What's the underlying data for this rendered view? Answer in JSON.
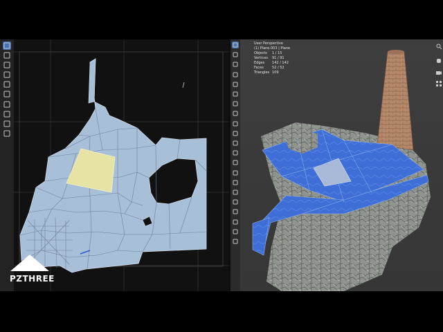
{
  "uv_editor": {
    "toolbar": [
      {
        "icon": "cursor-icon",
        "active": true
      },
      {
        "icon": "cursor-3d-icon",
        "active": false
      },
      {
        "icon": "move-icon",
        "active": false
      },
      {
        "icon": "rotate-icon",
        "active": false
      },
      {
        "icon": "scale-icon",
        "active": false
      },
      {
        "icon": "transform-icon",
        "active": false
      },
      {
        "icon": "annotate-icon",
        "active": false
      },
      {
        "icon": "grab-icon",
        "active": false
      },
      {
        "icon": "relax-icon",
        "active": false
      },
      {
        "icon": "pinch-icon",
        "active": false
      }
    ],
    "selected_face_color": "#e6e3a5",
    "island_color": "#a8bfd8"
  },
  "viewport": {
    "info": {
      "view": "User Perspective",
      "object": "(1) Plane.003 | Plane",
      "stats": [
        {
          "label": "Objects",
          "value": "1 / 15"
        },
        {
          "label": "Vertices",
          "value": "91 / 91"
        },
        {
          "label": "Edges",
          "value": "142 / 142"
        },
        {
          "label": "Faces",
          "value": "52 / 52"
        },
        {
          "label": "Triangles",
          "value": "109"
        }
      ]
    },
    "toolbar": [
      {
        "icon": "cursor-icon",
        "active": true
      },
      {
        "icon": "cursor-3d-icon",
        "active": false
      },
      {
        "icon": "move-icon",
        "active": false
      },
      {
        "icon": "rotate-icon",
        "active": false
      },
      {
        "icon": "scale-icon",
        "active": false
      },
      {
        "icon": "transform-icon",
        "active": false
      },
      {
        "icon": "annotate-icon",
        "active": false
      },
      {
        "icon": "measure-icon",
        "active": false
      },
      {
        "icon": "add-cube-icon",
        "active": false
      },
      {
        "icon": "extrude-icon",
        "active": false
      },
      {
        "icon": "inset-icon",
        "active": false
      },
      {
        "icon": "bevel-icon",
        "active": false
      },
      {
        "icon": "loop-cut-icon",
        "active": false
      },
      {
        "icon": "knife-icon",
        "active": false
      },
      {
        "icon": "poly-build-icon",
        "active": false
      },
      {
        "icon": "spin-icon",
        "active": false
      },
      {
        "icon": "smooth-icon",
        "active": false
      },
      {
        "icon": "edge-slide-icon",
        "active": false
      },
      {
        "icon": "shrink-fatten-icon",
        "active": false
      },
      {
        "icon": "shear-icon",
        "active": false
      },
      {
        "icon": "rip-region-icon",
        "active": false
      }
    ],
    "water_color": "#3f6fd6",
    "selected_face_color": "#a9b9d8"
  },
  "logo": {
    "text": "PZTHREE"
  }
}
